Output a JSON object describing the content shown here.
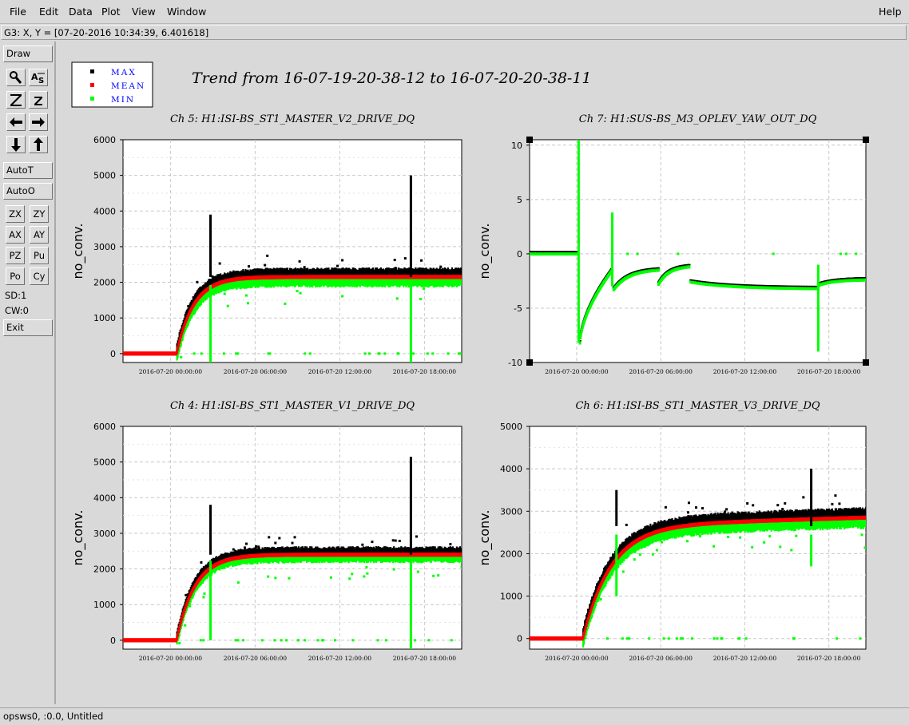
{
  "menu": {
    "file": "File",
    "edit": "Edit",
    "data": "Data",
    "plot": "Plot",
    "view": "View",
    "window": "Window",
    "help": "Help"
  },
  "coord_readout": "G3: X, Y = [07-20-2016 10:34:39, 6.401618]",
  "toolbar": {
    "draw": "Draw",
    "autot": "AutoT",
    "autoo": "AutoO",
    "zx": "ZX",
    "zy": "ZY",
    "ax": "AX",
    "ay": "AY",
    "pz": "PZ",
    "pu": "Pu",
    "po": "Po",
    "cy": "Cy",
    "sd": "SD:1",
    "cw": "CW:0",
    "exit": "Exit"
  },
  "status": "opsws0, :0.0, Untitled",
  "figure_title": "Trend from 16-07-19-20-38-12 to 16-07-20-20-38-11",
  "colors": {
    "max": "#000000",
    "mean": "#ff0000",
    "min": "#00ff00",
    "legend_text": "#0000ff"
  },
  "chart_data": [
    {
      "type": "scatter",
      "title": "Ch 5: H1:ISI-BS_ST1_MASTER_V2_DRIVE_DQ",
      "ylabel": "no_conv.",
      "xlabel": "",
      "ylim": [
        -250,
        6000
      ],
      "yticks": [
        0,
        1000,
        2000,
        3000,
        4000,
        5000,
        6000
      ],
      "xlim": [
        0,
        24
      ],
      "x_start": "2016-07-19 20:38:12",
      "xticks": [
        {
          "x": 3.36,
          "label": "2016-07-20 00:00:00"
        },
        {
          "x": 9.36,
          "label": "2016-07-20 06:00:00"
        },
        {
          "x": 15.36,
          "label": "2016-07-20 12:00:00"
        },
        {
          "x": 21.36,
          "label": "2016-07-20 18:00:00"
        }
      ],
      "legend": [
        {
          "name": "MAX"
        },
        {
          "name": "MEAN"
        },
        {
          "name": "MIN"
        }
      ],
      "grid": true,
      "profile": {
        "t0": 3.8,
        "level": 2150,
        "tau": 1.2,
        "max_off": 200,
        "min_off": 230,
        "spread": 70
      },
      "spikes": [
        {
          "x": 6.2,
          "max": 3900
        },
        {
          "x": 20.4,
          "max": 5000
        }
      ],
      "min_dips": [
        {
          "x": 6.2,
          "min": -650
        },
        {
          "x": 20.4,
          "min": -450
        }
      ]
    },
    {
      "type": "scatter",
      "title": "Ch 7: H1:SUS-BS_M3_OPLEV_YAW_OUT_DQ",
      "ylabel": "no_conv.",
      "xlabel": "",
      "ylim": [
        -10,
        10.5
      ],
      "yticks": [
        -10,
        -5,
        0,
        5,
        10
      ],
      "xlim": [
        0,
        24
      ],
      "x_start": "2016-07-19 20:38:12",
      "xticks": [
        {
          "x": 3.36,
          "label": "2016-07-20 00:00:00"
        },
        {
          "x": 9.36,
          "label": "2016-07-20 06:00:00"
        },
        {
          "x": 15.36,
          "label": "2016-07-20 12:00:00"
        },
        {
          "x": 21.36,
          "label": "2016-07-20 18:00:00"
        }
      ],
      "legend": [
        {
          "name": "MAX"
        },
        {
          "name": "MEAN"
        },
        {
          "name": "MIN"
        }
      ],
      "grid": true,
      "segments": [
        {
          "x": [
            0,
            3.4
          ],
          "y": [
            0,
            0
          ]
        },
        {
          "x": [
            3.6,
            5.9
          ],
          "y": [
            -8.2,
            -1.5
          ]
        },
        {
          "x": [
            6.0,
            9.2
          ],
          "y": [
            -3.3,
            -1.5
          ]
        },
        {
          "x": [
            9.2,
            11.4
          ],
          "y": [
            -2.8,
            -1.2
          ]
        },
        {
          "x": [
            11.5,
            20.5
          ],
          "y": [
            -2.6,
            -3.2
          ]
        },
        {
          "x": [
            20.6,
            24
          ],
          "y": [
            -2.9,
            -2.4
          ]
        }
      ],
      "spikes": [
        {
          "x": 3.5,
          "min": -8.2,
          "max": 10.5
        },
        {
          "x": 5.9,
          "min": -3.0,
          "max": 3.8
        },
        {
          "x": 20.6,
          "min": -9.0,
          "max": -1.0
        }
      ]
    },
    {
      "type": "scatter",
      "title": "Ch 4: H1:ISI-BS_ST1_MASTER_V1_DRIVE_DQ",
      "ylabel": "no_conv.",
      "xlabel": "",
      "ylim": [
        -250,
        6000
      ],
      "yticks": [
        0,
        1000,
        2000,
        3000,
        4000,
        5000,
        6000
      ],
      "xlim": [
        0,
        24
      ],
      "x_start": "2016-07-19 20:38:12",
      "xticks": [
        {
          "x": 3.36,
          "label": "2016-07-20 00:00:00"
        },
        {
          "x": 9.36,
          "label": "2016-07-20 06:00:00"
        },
        {
          "x": 15.36,
          "label": "2016-07-20 12:00:00"
        },
        {
          "x": 21.36,
          "label": "2016-07-20 18:00:00"
        }
      ],
      "legend": [
        {
          "name": "MAX"
        },
        {
          "name": "MEAN"
        },
        {
          "name": "MIN"
        }
      ],
      "grid": true,
      "profile": {
        "t0": 3.8,
        "level": 2400,
        "tau": 1.3,
        "max_off": 170,
        "min_off": 170,
        "spread": 70
      },
      "spikes": [
        {
          "x": 6.2,
          "max": 3800
        },
        {
          "x": 20.4,
          "max": 5150
        }
      ],
      "min_dips": [
        {
          "x": 6.2,
          "min": 0
        },
        {
          "x": 20.4,
          "min": -500
        }
      ]
    },
    {
      "type": "scatter",
      "title": "Ch 6: H1:ISI-BS_ST1_MASTER_V3_DRIVE_DQ",
      "ylabel": "no_conv.",
      "xlabel": "",
      "ylim": [
        -250,
        5000
      ],
      "yticks": [
        0,
        1000,
        2000,
        3000,
        4000,
        5000
      ],
      "xlim": [
        0,
        24
      ],
      "x_start": "2016-07-19 20:38:12",
      "xticks": [
        {
          "x": 3.36,
          "label": "2016-07-20 00:00:00"
        },
        {
          "x": 9.36,
          "label": "2016-07-20 06:00:00"
        },
        {
          "x": 15.36,
          "label": "2016-07-20 12:00:00"
        },
        {
          "x": 21.36,
          "label": "2016-07-20 18:00:00"
        }
      ],
      "legend": [
        {
          "name": "MAX"
        },
        {
          "name": "MEAN"
        },
        {
          "name": "MIN"
        }
      ],
      "grid": true,
      "profile": {
        "t0": 3.8,
        "level": 2650,
        "tau": 2.0,
        "max_off": 180,
        "min_off": 200,
        "spread": 70,
        "drift": 200
      },
      "spikes": [
        {
          "x": 6.2,
          "max": 3500
        },
        {
          "x": 20.1,
          "max": 4000
        }
      ],
      "min_dips": [
        {
          "x": 6.2,
          "min": 1000
        },
        {
          "x": 20.1,
          "min": 1700
        }
      ]
    }
  ]
}
